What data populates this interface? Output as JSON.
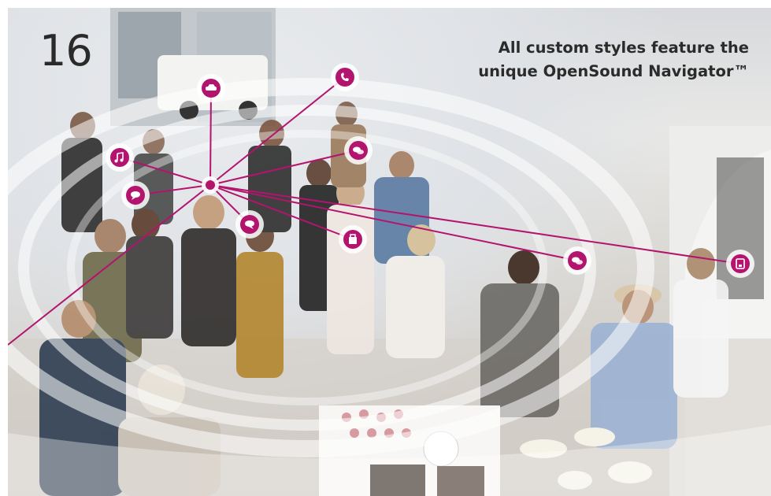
{
  "page": {
    "number": "16",
    "headline_line1": "All custom styles feature the",
    "headline_line2": "unique OpenSound Navigator™"
  },
  "colors": {
    "accent": "#b2146e",
    "ring": "#ffffff"
  },
  "sound_sources": [
    {
      "name": "phone-call-icon"
    },
    {
      "name": "conversation-icon"
    },
    {
      "name": "music-icon"
    },
    {
      "name": "speech-icon"
    },
    {
      "name": "car-icon"
    },
    {
      "name": "chat-icon"
    },
    {
      "name": "shopping-bag-icon"
    },
    {
      "name": "chat-icon"
    },
    {
      "name": "coffee-machine-icon"
    }
  ]
}
